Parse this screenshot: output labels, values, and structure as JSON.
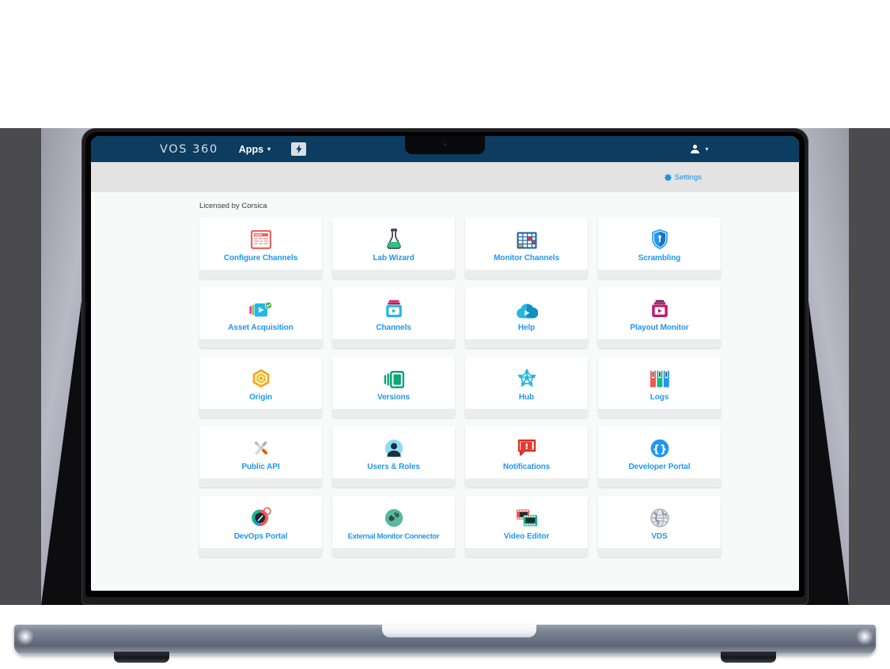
{
  "navbar": {
    "brand": "VOS 360",
    "apps_label": "Apps",
    "caret": "▾",
    "bolt_icon": "bolt-icon",
    "user_icon": "user-icon",
    "user_caret": "▾"
  },
  "subbar": {
    "settings_label": "Settings",
    "settings_icon": "gear-icon"
  },
  "content": {
    "licensed_text": "Licensed by Corsica"
  },
  "colors": {
    "navbar_bg": "#0d3c61",
    "subbar_bg": "#e3e3e3",
    "content_bg": "#f8f9f9",
    "card_bg": "#ffffff",
    "card_footer_bg": "#eceded",
    "label_blue": "#2196f3",
    "settings_blue": "#1a8fe3"
  },
  "apps": [
    {
      "label": "Configure Channels",
      "icon": "configure-channels-icon"
    },
    {
      "label": "Lab Wizard",
      "icon": "lab-wizard-icon"
    },
    {
      "label": "Monitor Channels",
      "icon": "monitor-channels-icon"
    },
    {
      "label": "Scrambling",
      "icon": "scrambling-shield-icon"
    },
    {
      "label": "Asset Acquisition",
      "icon": "asset-acquisition-icon"
    },
    {
      "label": "Channels",
      "icon": "channels-icon"
    },
    {
      "label": "Help",
      "icon": "help-cloud-icon"
    },
    {
      "label": "Playout Monitor",
      "icon": "playout-monitor-icon"
    },
    {
      "label": "Origin",
      "icon": "origin-hex-icon"
    },
    {
      "label": "Versions",
      "icon": "versions-icon"
    },
    {
      "label": "Hub",
      "icon": "hub-network-icon"
    },
    {
      "label": "Logs",
      "icon": "logs-binders-icon"
    },
    {
      "label": "Public API",
      "icon": "public-api-tools-icon"
    },
    {
      "label": "Users & Roles",
      "icon": "users-roles-icon"
    },
    {
      "label": "Notifications",
      "icon": "notifications-icon"
    },
    {
      "label": "Developer Portal",
      "icon": "developer-portal-braces-icon"
    },
    {
      "label": "DevOps Portal",
      "icon": "devops-portal-compass-icon"
    },
    {
      "label": "External Monitor Connector",
      "icon": "external-monitor-connector-icon"
    },
    {
      "label": "Video Editor",
      "icon": "video-editor-icon"
    },
    {
      "label": "VDS",
      "icon": "vds-globe-icon"
    }
  ]
}
